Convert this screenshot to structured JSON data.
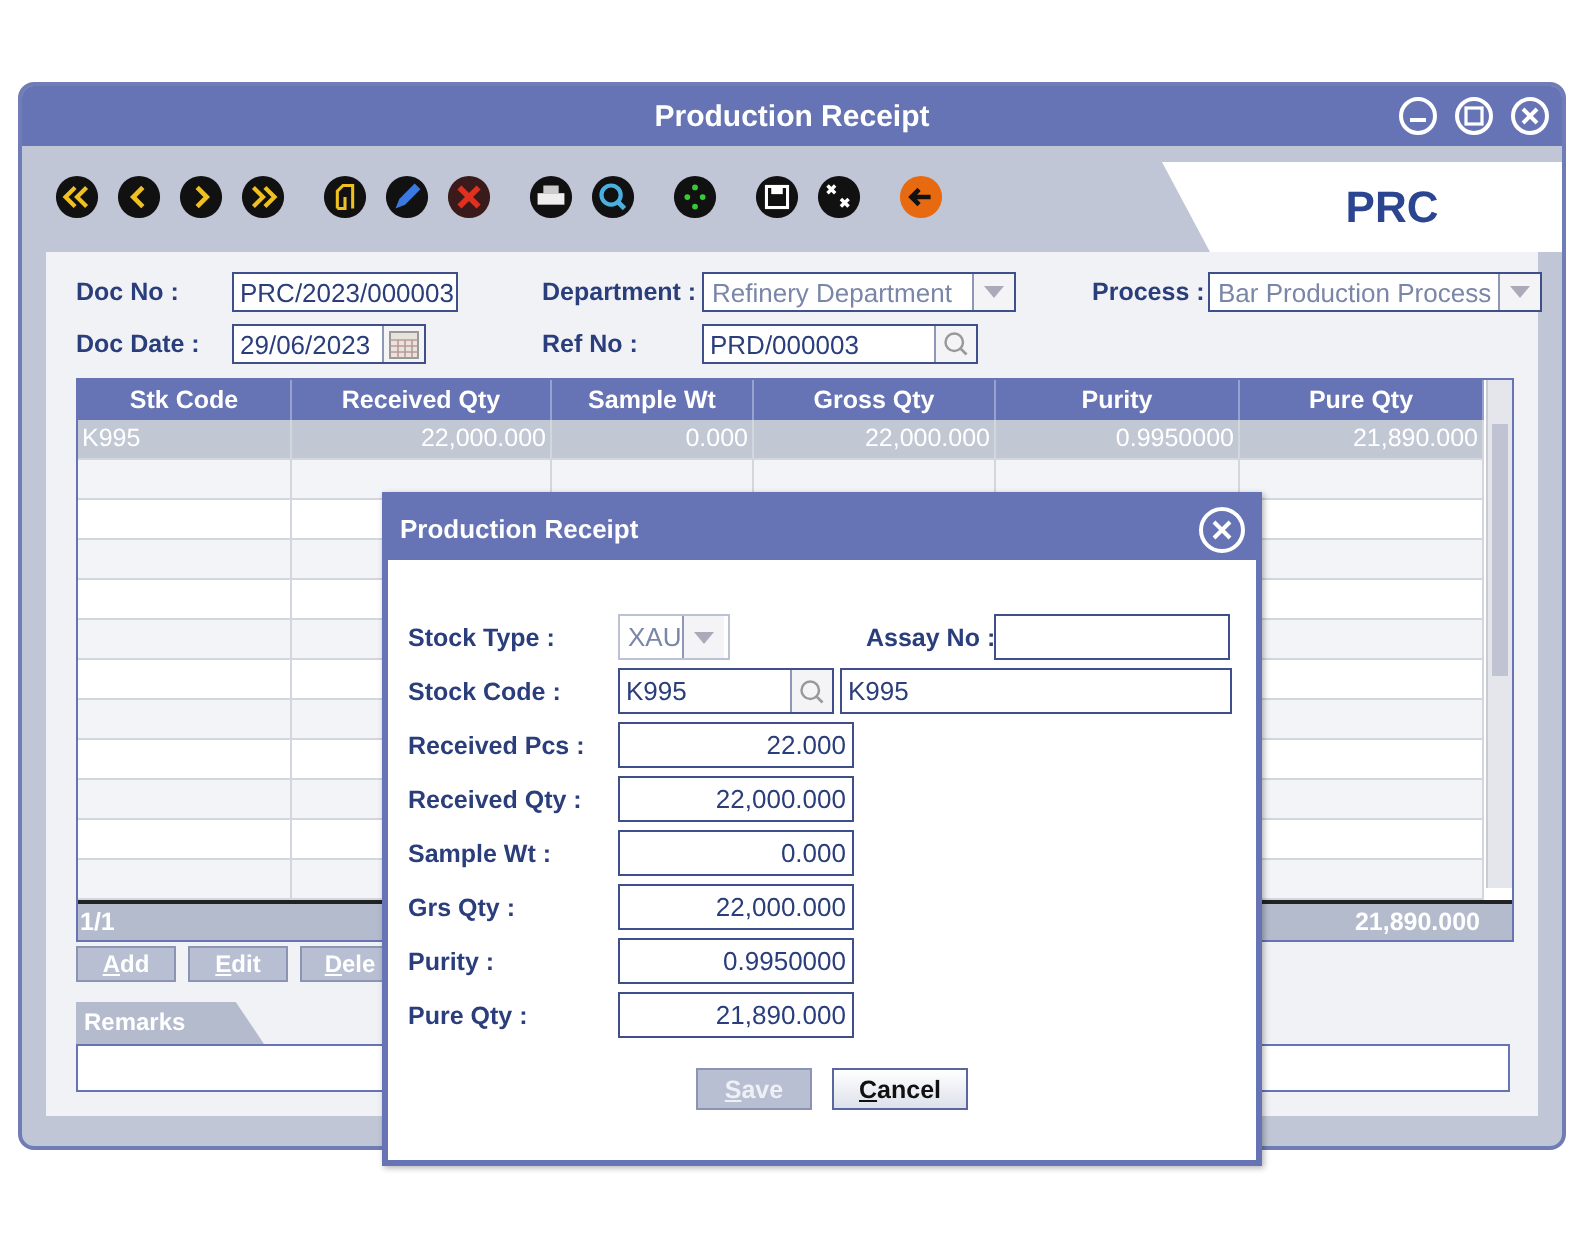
{
  "window": {
    "title": "Production Receipt"
  },
  "module_tab": {
    "label": "PRC"
  },
  "header_fields": [
    {
      "kind": "text",
      "label": "Doc No :",
      "value": "PRC/2023/000003"
    },
    {
      "kind": "dropdown",
      "label": "Department :",
      "value": "Refinery Department"
    },
    {
      "kind": "dropdown",
      "label": "Process :",
      "value": "Bar Production Process"
    },
    {
      "kind": "date",
      "label": "Doc Date :",
      "value": "29/06/2023"
    },
    {
      "kind": "lookup",
      "label": "Ref No :",
      "value": "PRD/000003"
    }
  ],
  "table": {
    "columns": [
      "Stk Code",
      "Received Qty",
      "Sample Wt",
      "Gross Qty",
      "Purity",
      "Pure Qty"
    ],
    "rows": [
      {
        "selected": true,
        "cells": [
          "K995",
          "22,000.000",
          "0.000",
          "22,000.000",
          "0.9950000",
          "21,890.000"
        ]
      }
    ],
    "footer": {
      "pager": "1/1",
      "total": "21,890.000"
    }
  },
  "row_buttons": [
    {
      "label": "Add"
    },
    {
      "label": "Edit"
    },
    {
      "label": "Dele"
    }
  ],
  "remarks": {
    "tab": "Remarks"
  },
  "dialog": {
    "title": "Production Receipt",
    "stock_type": {
      "label": "Stock Type :",
      "value": "XAU"
    },
    "assay_no": {
      "label": "Assay No :"
    },
    "stock_code": {
      "label": "Stock Code :",
      "value": "K995",
      "description": "K995"
    },
    "fields": [
      {
        "label": "Received Pcs :",
        "value": "22.000"
      },
      {
        "label": "Received Qty :",
        "value": "22,000.000"
      },
      {
        "label": "Sample Wt :",
        "value": "0.000"
      },
      {
        "label": "Grs Qty :",
        "value": "22,000.000"
      },
      {
        "label": "Purity :",
        "value": "0.9950000"
      },
      {
        "label": "Pure Qty :",
        "value": "21,890.000"
      }
    ],
    "buttons": [
      {
        "label": "Save",
        "disabled": true
      },
      {
        "label": "Cancel",
        "disabled": false
      }
    ]
  }
}
